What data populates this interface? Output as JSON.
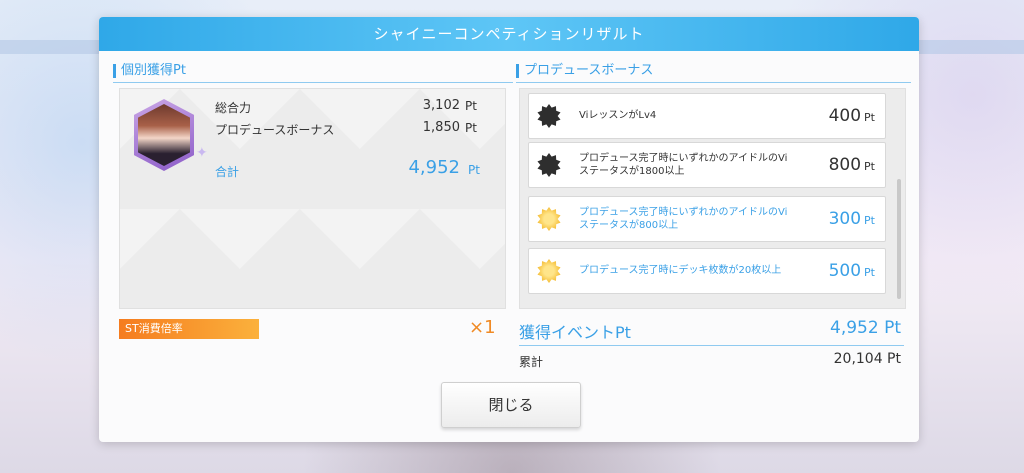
{
  "title": "シャイニーコンペティションリザルト",
  "left": {
    "header": "個別獲得Pt",
    "stats": [
      {
        "label": "総合力",
        "value": "3,102",
        "unit": "Pt"
      },
      {
        "label": "プロデュースボーナス",
        "value": "1,850",
        "unit": "Pt"
      }
    ],
    "total": {
      "label": "合計",
      "value": "4,952",
      "unit": "Pt"
    },
    "st": {
      "label": "ST消費倍率",
      "multiplier": "×1"
    }
  },
  "right": {
    "header": "プロデュースボーナス",
    "bonuses": [
      {
        "text": "ViレッスンがLv4",
        "points": "400",
        "unit": "Pt",
        "icon": "dark-star-badge-icon"
      },
      {
        "text": "プロデュース完了時にいずれかのアイドルのViステータスが1800以上",
        "points": "800",
        "unit": "Pt",
        "icon": "dark-star-badge-icon"
      },
      {
        "text": "プロデュース完了時にいずれかのアイドルのViステータスが800以上",
        "points": "300",
        "unit": "Pt",
        "icon": "gold-star-badge-icon"
      },
      {
        "text": "プロデュース完了時にデッキ枚数が20枚以上",
        "points": "500",
        "unit": "Pt",
        "icon": "gold-star-badge-icon"
      }
    ],
    "event": {
      "label": "獲得イベントPt",
      "value": "4,952 Pt"
    },
    "cumulative": {
      "label": "累計",
      "value": "20,104 Pt"
    }
  },
  "close_button": "閉じる",
  "colors": {
    "accent": "#3aa0e6",
    "orange": "#f57c1f",
    "title_bar": "#2fa8e8"
  }
}
